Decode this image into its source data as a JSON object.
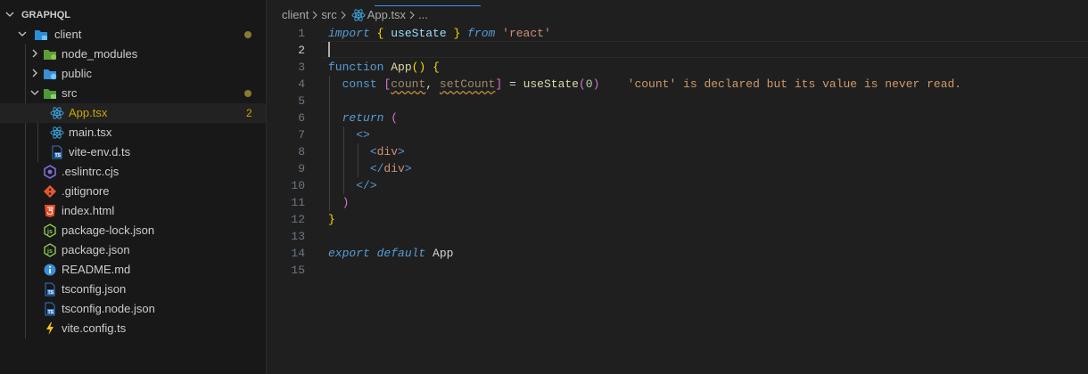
{
  "explorer": {
    "root_label": "GRAPHQL",
    "items": [
      {
        "label": "client",
        "badge": ""
      },
      {
        "label": "node_modules",
        "badge": ""
      },
      {
        "label": "public",
        "badge": ""
      },
      {
        "label": "src",
        "badge": ""
      },
      {
        "label": "App.tsx",
        "badge": "2"
      },
      {
        "label": "main.tsx",
        "badge": ""
      },
      {
        "label": "vite-env.d.ts",
        "badge": ""
      },
      {
        "label": ".eslintrc.cjs",
        "badge": ""
      },
      {
        "label": ".gitignore",
        "badge": ""
      },
      {
        "label": "index.html",
        "badge": ""
      },
      {
        "label": "package-lock.json",
        "badge": ""
      },
      {
        "label": "package.json",
        "badge": ""
      },
      {
        "label": "README.md",
        "badge": ""
      },
      {
        "label": "tsconfig.json",
        "badge": ""
      },
      {
        "label": "tsconfig.node.json",
        "badge": ""
      },
      {
        "label": "vite.config.ts",
        "badge": ""
      }
    ]
  },
  "breadcrumb": {
    "parts": [
      "client",
      "src",
      "App.tsx",
      "..."
    ]
  },
  "editor": {
    "line_numbers": [
      "1",
      "2",
      "3",
      "4",
      "5",
      "6",
      "7",
      "8",
      "9",
      "10",
      "11",
      "12",
      "13",
      "14",
      "15"
    ],
    "code": {
      "l1": {
        "import": "import",
        "ob": "{",
        "name": "useState",
        "cb": "}",
        "from": "from",
        "src": "'react'"
      },
      "l3": {
        "function": "function",
        "name": "App",
        "parens": "()",
        "ob": "{"
      },
      "l4": {
        "const": "const",
        "ob": "[",
        "v1": "count",
        "comma": ",",
        "v2": "setCount",
        "cb": "]",
        "eq": "=",
        "call": "useState",
        "op": "(",
        "arg": "0",
        "cp": ")",
        "diagnostic": "'count' is declared but its value is never read."
      },
      "l6": {
        "return": "return",
        "op": "("
      },
      "l7": {
        "frag": "<>"
      },
      "l8": {
        "lt": "<",
        "tag": "div",
        "gt": ">"
      },
      "l9": {
        "lt": "</",
        "tag": "div",
        "gt": ">"
      },
      "l10": {
        "frag": "</>"
      },
      "l11": {
        "cp": ")"
      },
      "l12": {
        "cb": "}"
      },
      "l14": {
        "export": "export",
        "default": "default",
        "name": "App"
      }
    }
  },
  "colors": {
    "accent": "#3794ff",
    "warning": "#cca700",
    "modified_dot": "#8a7a30"
  }
}
